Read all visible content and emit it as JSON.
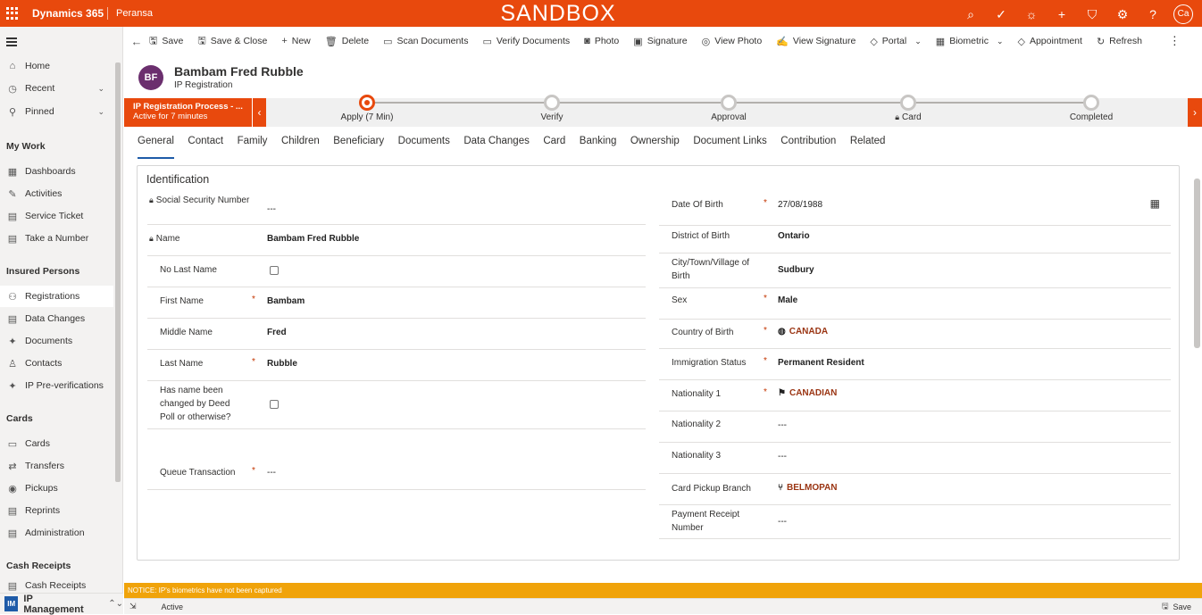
{
  "topbar": {
    "app": "Dynamics 365",
    "env": "Peransa",
    "banner": "SANDBOX",
    "user": "Ca",
    "icons": [
      "search-icon",
      "task-icon",
      "lightbulb-icon",
      "plus-icon",
      "filter-icon",
      "gear-icon",
      "help-icon"
    ]
  },
  "sidebar": {
    "items": [
      {
        "label": "Home",
        "icon": "⌂"
      },
      {
        "label": "Recent",
        "icon": "◷",
        "chev": "⌄"
      },
      {
        "label": "Pinned",
        "icon": "⚲",
        "chev": "⌄"
      }
    ],
    "my_work": {
      "header": "My Work",
      "items": [
        {
          "label": "Dashboards",
          "icon": "▦"
        },
        {
          "label": "Activities",
          "icon": "✎"
        },
        {
          "label": "Service Ticket",
          "icon": "▤"
        },
        {
          "label": "Take a Number",
          "icon": "▤"
        }
      ]
    },
    "insured": {
      "header": "Insured Persons",
      "items": [
        {
          "label": "Registrations",
          "icon": "⚇"
        },
        {
          "label": "Data Changes",
          "icon": "▤"
        },
        {
          "label": "Documents",
          "icon": "✦"
        },
        {
          "label": "Contacts",
          "icon": "♙"
        },
        {
          "label": "IP Pre-verifications",
          "icon": "✦"
        }
      ]
    },
    "cards": {
      "header": "Cards",
      "items": [
        {
          "label": "Cards",
          "icon": "▭"
        },
        {
          "label": "Transfers",
          "icon": "⇄"
        },
        {
          "label": "Pickups",
          "icon": "◉"
        },
        {
          "label": "Reprints",
          "icon": "▤"
        },
        {
          "label": "Administration",
          "icon": "▤"
        }
      ]
    },
    "cash": {
      "header": "Cash Receipts",
      "items": [
        {
          "label": "Cash Receipts",
          "icon": "▤"
        }
      ]
    },
    "area": {
      "badge": "IM",
      "label": "IP Management",
      "chev": "⌃⌄"
    }
  },
  "commands": [
    {
      "label": "Save",
      "icon": "🖫"
    },
    {
      "label": "Save & Close",
      "icon": "🖫"
    },
    {
      "label": "New",
      "icon": "+"
    },
    {
      "label": "Delete",
      "icon": "🗑"
    },
    {
      "label": "Scan Documents",
      "icon": "▭"
    },
    {
      "label": "Verify Documents",
      "icon": "▭"
    },
    {
      "label": "Photo",
      "icon": "◙"
    },
    {
      "label": "Signature",
      "icon": "▣"
    },
    {
      "label": "View Photo",
      "icon": "◎"
    },
    {
      "label": "View Signature",
      "icon": "✍"
    },
    {
      "label": "Portal",
      "icon": "◇",
      "dd": "⌄"
    },
    {
      "label": "Biometric",
      "icon": "▦",
      "dd": "⌄"
    },
    {
      "label": "Appointment",
      "icon": "◇"
    },
    {
      "label": "Refresh",
      "icon": "↻"
    }
  ],
  "more": "⋮",
  "record": {
    "initials": "BF",
    "title": "Bambam Fred Rubble",
    "subtitle": "IP Registration"
  },
  "bpf": {
    "process": "IP Registration Process - ...",
    "active_for": "Active for 7 minutes",
    "stages": [
      {
        "label": "Apply  (7 Min)",
        "current": true
      },
      {
        "label": "Verify"
      },
      {
        "label": "Approval"
      },
      {
        "label": "Card",
        "locked": true
      },
      {
        "label": "Completed"
      }
    ]
  },
  "tabs": [
    "General",
    "Contact",
    "Family",
    "Children",
    "Beneficiary",
    "Documents",
    "Data Changes",
    "Card",
    "Banking",
    "Ownership",
    "Document Links",
    "Contribution",
    "Related"
  ],
  "section": {
    "title": "Identification",
    "left": [
      {
        "label": "Social Security Number",
        "value": "---",
        "locked": true
      },
      {
        "label": "Name",
        "value": "Bambam Fred Rubble",
        "locked": true
      },
      {
        "label": "No Last Name",
        "checkbox": true
      },
      {
        "label": "First Name",
        "value": "Bambam",
        "required": true
      },
      {
        "label": "Middle Name",
        "value": "Fred"
      },
      {
        "label": "Last Name",
        "value": "Rubble",
        "required": true
      },
      {
        "label": "Has name been changed by Deed Poll or otherwise?",
        "checkbox": true
      },
      {
        "label": "Queue Transaction",
        "value": "---",
        "required": true
      }
    ],
    "right": [
      {
        "label": "Date Of Birth",
        "value": "27/08/1988",
        "required": true
      },
      {
        "label": "District of Birth",
        "value": "Ontario"
      },
      {
        "label": "City/Town/Village of Birth",
        "value": "Sudbury"
      },
      {
        "label": "Sex",
        "value": "Male",
        "required": true
      },
      {
        "label": "Country of Birth",
        "value": "CANADA",
        "required": true
      },
      {
        "label": "Immigration Status",
        "value": "Permanent Resident",
        "required": true
      },
      {
        "label": "Nationality 1",
        "value": "CANADIAN",
        "required": true
      },
      {
        "label": "Nationality 2",
        "value": "---"
      },
      {
        "label": "Nationality 3",
        "value": "---"
      },
      {
        "label": "Card Pickup Branch",
        "value": "BELMOPAN"
      },
      {
        "label": "Payment Receipt Number",
        "value": "---"
      }
    ]
  },
  "notice": "NOTICE: IP's biometrics have not been captured",
  "status": {
    "state": "Active",
    "save": "Save"
  }
}
